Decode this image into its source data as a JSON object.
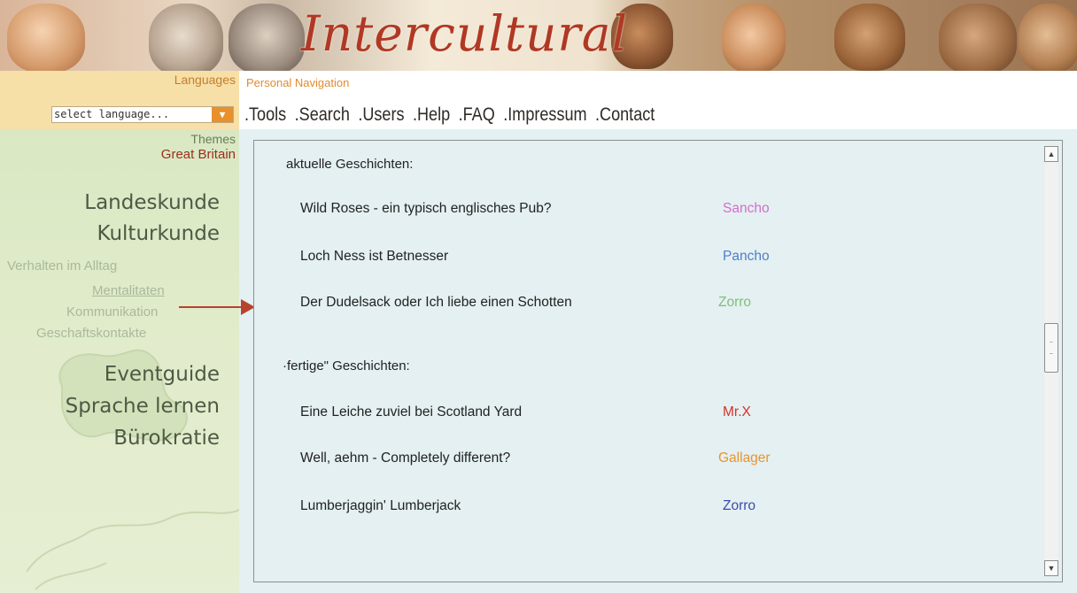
{
  "banner": {
    "brand": "Intercultural"
  },
  "sidebar": {
    "languages_label": "Languages",
    "language_select": "select language...",
    "themes_label": "Themes",
    "region": "Great Britain",
    "nav": {
      "landeskunde": "Landeskunde",
      "kulturkunde": "Kulturkunde",
      "verhalten": "Verhalten im Alltag",
      "mentalitaten": "Mentalitaten",
      "kommunikation": "Kommunikation",
      "geschaftskontakte": "Geschaftskontakte",
      "eventguide": "Eventguide",
      "sprache": "Sprache lernen",
      "burokratie": "Bürokratie"
    }
  },
  "header": {
    "personal_nav_label": "Personal Navigation",
    "menu": [
      ".Tools",
      ".Search",
      ".Users",
      ".Help",
      ".FAQ",
      ".Impressum",
      ".Contact"
    ]
  },
  "content": {
    "section1_title": "aktuelle Geschichten:",
    "section1_rows": [
      {
        "title": "Wild Roses - ein typisch englisches    Pub?",
        "author": "Sancho"
      },
      {
        "title": "Loch Ness ist Betnesser",
        "author": "Pancho"
      },
      {
        "title": "Der Dudelsack oder Ich liebe einen Schotten",
        "author": "Zorro"
      }
    ],
    "section2_title": "·fertige\" Geschichten:",
    "section2_rows": [
      {
        "title": "Eine Leiche zuviel bei Scotland Yard",
        "author": "Mr.X"
      },
      {
        "title": "Well, aehm - Completely different?",
        "author": "Gallager"
      },
      {
        "title": "Lumberjaggin' Lumberjack",
        "author": "Zorro"
      }
    ]
  },
  "colors": {
    "brand": "#b03824",
    "author_sancho": "#d36fc8",
    "author_pancho": "#4f7fc6",
    "author_zorro_1": "#7fbf7a",
    "author_mrx": "#d3322a",
    "author_gallager": "#e8942f",
    "author_zorro_2": "#3d4ca8",
    "pointer": "#b8432c"
  },
  "icons": {
    "language_dropdown": "chevron-down-icon",
    "pointer": "arrow-right-icon",
    "scroll_up": "scroll-up-icon",
    "scroll_down": "scroll-down-icon"
  }
}
